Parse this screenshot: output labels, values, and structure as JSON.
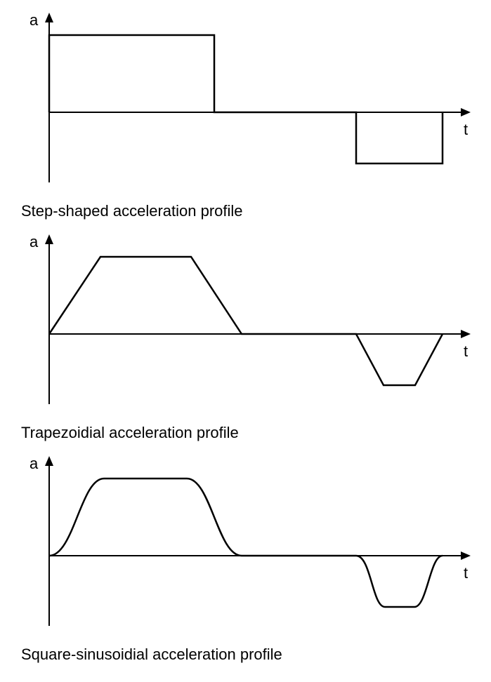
{
  "chart_data": [
    {
      "type": "line",
      "title": "Step-shaped acceleration profile",
      "xlabel": "t",
      "ylabel": "a",
      "series": [
        {
          "name": "acceleration",
          "x": [
            0,
            0,
            0.42,
            0.42,
            0.78,
            0.78,
            1.0,
            1.0
          ],
          "values": [
            0,
            1,
            1,
            0,
            0,
            -0.66,
            -0.66,
            0
          ]
        }
      ],
      "ylim": [
        -1,
        1
      ],
      "xlim": [
        0,
        1.05
      ]
    },
    {
      "type": "line",
      "title": "Trapezoidial acceleration profile",
      "xlabel": "t",
      "ylabel": "a",
      "series": [
        {
          "name": "acceleration",
          "x": [
            0,
            0.13,
            0.36,
            0.49,
            0.78,
            0.85,
            0.93,
            1.0
          ],
          "values": [
            0,
            1,
            1,
            0,
            0,
            -0.66,
            -0.66,
            0
          ]
        }
      ],
      "ylim": [
        -1,
        1
      ],
      "xlim": [
        0,
        1.05
      ]
    },
    {
      "type": "line",
      "title": "Square-sinusoidial acceleration profile",
      "xlabel": "t",
      "ylabel": "a",
      "series": [
        {
          "name": "acceleration",
          "x": [
            0,
            0.03,
            0.07,
            0.11,
            0.14,
            0.35,
            0.38,
            0.42,
            0.46,
            0.49,
            0.78,
            0.8,
            0.82,
            0.84,
            0.85,
            0.93,
            0.945,
            0.965,
            0.985,
            1.0
          ],
          "values": [
            0,
            0.1,
            0.4,
            0.8,
            1,
            1,
            0.8,
            0.4,
            0.1,
            0,
            0,
            -0.1,
            -0.4,
            -0.6,
            -0.66,
            -0.66,
            -0.6,
            -0.4,
            -0.1,
            0
          ]
        }
      ],
      "ylim": [
        -1,
        1
      ],
      "xlim": [
        0,
        1.05
      ]
    }
  ]
}
